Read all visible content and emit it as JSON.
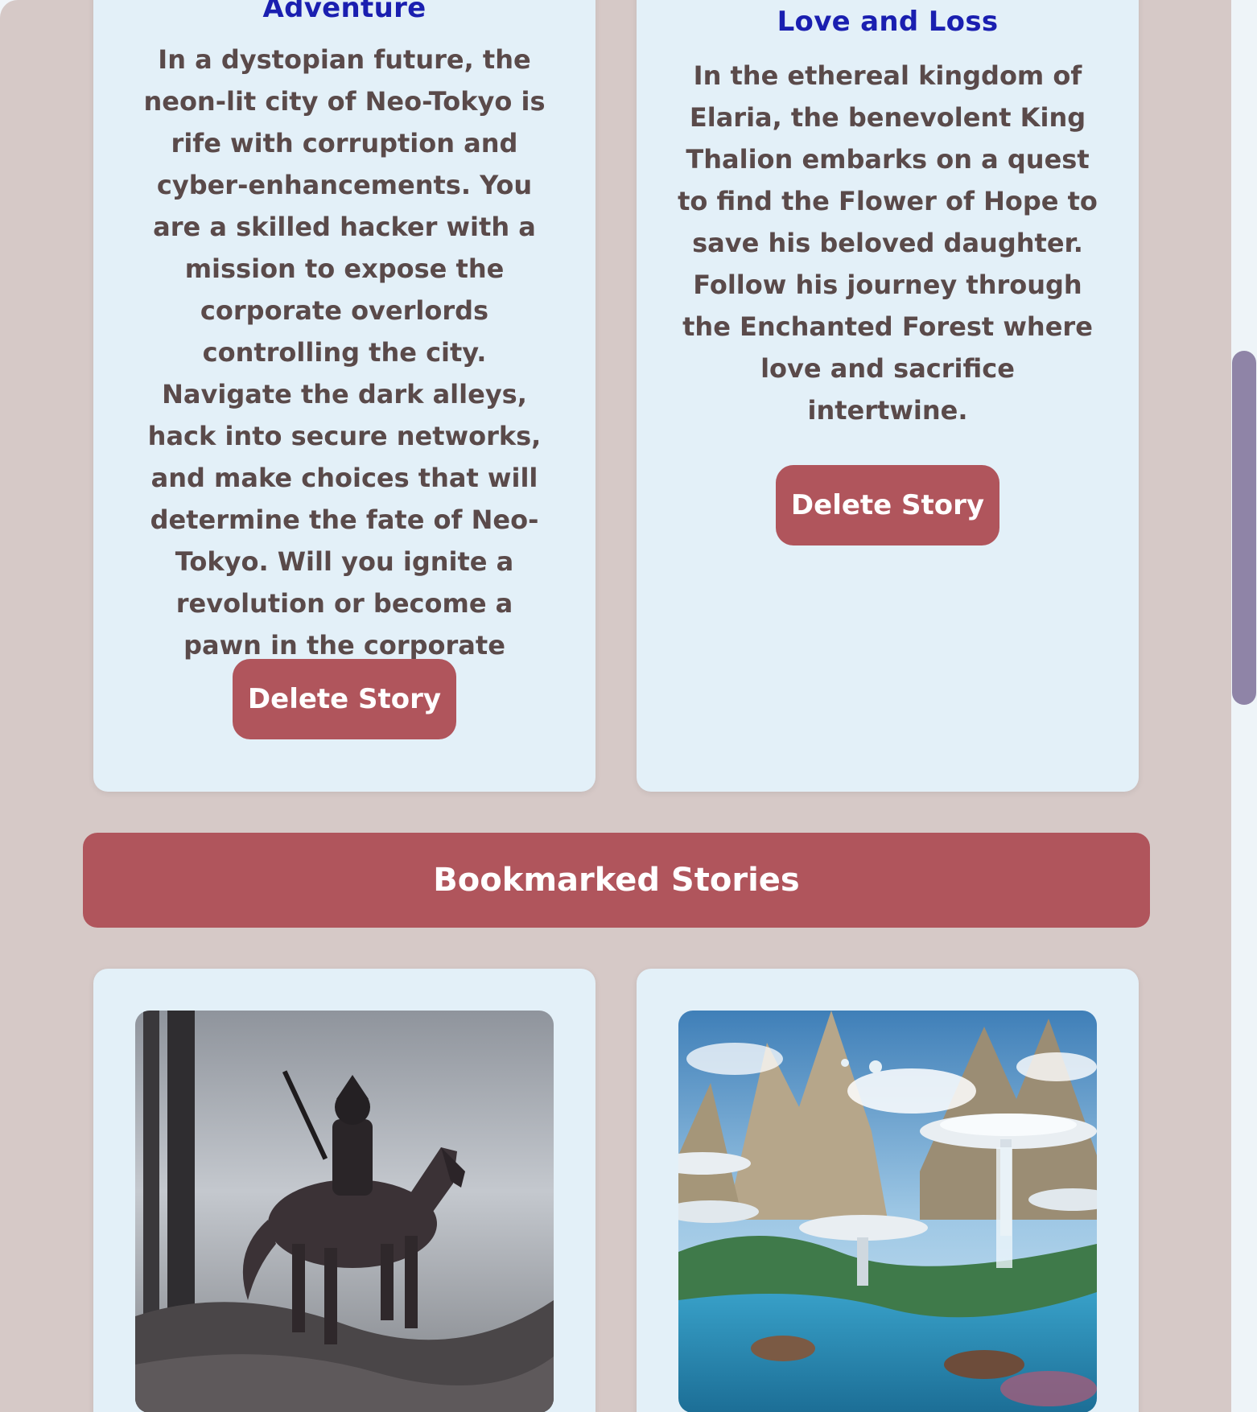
{
  "stories": [
    {
      "title": "Adventure",
      "text": "In a dystopian future, the neon-lit city of Neo-Tokyo is rife with corruption and cyber-enhancements. You are a skilled hacker with a mission to expose the corporate overlords controlling the city. Navigate the dark alleys, hack into secure networks, and make choices that will determine the fate of Neo-Tokyo. Will you ignite a revolution or become a pawn in the corporate game?",
      "delete_label": "Delete Story"
    },
    {
      "title": "Love and Loss",
      "text": "In the ethereal kingdom of Elaria, the benevolent King Thalion embarks on a quest to find the Flower of Hope to save his beloved daughter. Follow his journey through the Enchanted Forest where love and sacrifice intertwine.",
      "delete_label": "Delete Story"
    }
  ],
  "bookmarked": {
    "header": "Bookmarked Stories"
  },
  "colors": {
    "page_bg": "#d6c9c7",
    "card_bg": "#e3f0f8",
    "accent": "#b0555c",
    "title": "#1a1fb0",
    "body_text": "#5a4a4a",
    "scrollbar_thumb": "#8f84a7"
  }
}
